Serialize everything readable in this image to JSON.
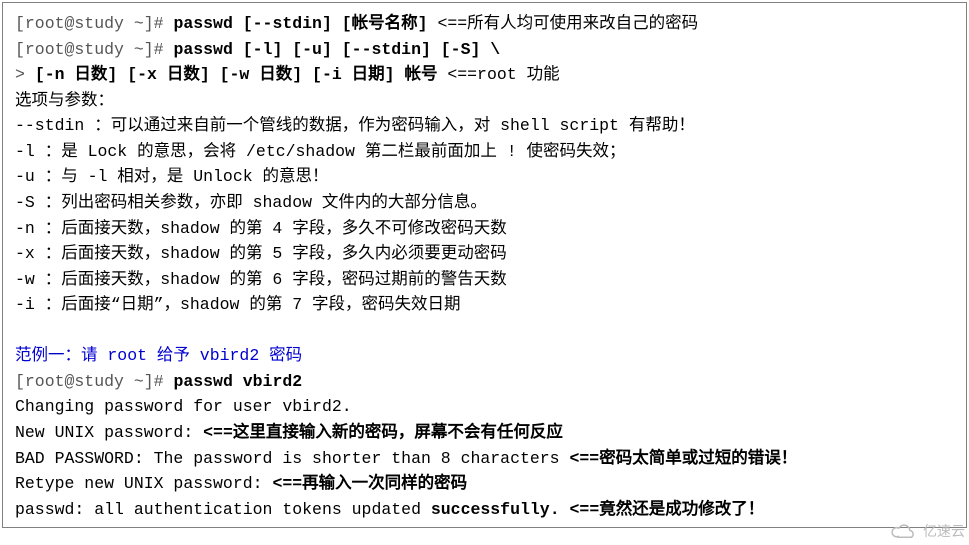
{
  "l01_prompt": "[root@study ~]# ",
  "l01_cmd": "passwd [--stdin] [帐号名称]",
  "l01_rem": "  <==所有人均可使用来改自己的密码",
  "l02_prompt": "[root@study ~]# ",
  "l02_cmd": "passwd [-l] [-u] [--stdin] [-S] \\",
  "l03_cont": ">  ",
  "l03_cmd": "[-n 日数] [-x 日数] [-w 日数] [-i 日期] 帐号",
  "l03_rem": " <==root 功能",
  "l04": "选项与参数：",
  "l05": "--stdin ：可以通过来自前一个管线的数据，作为密码输入，对 shell script 有帮助！",
  "l06": "-l  ：是 Lock 的意思，会将 /etc/shadow 第二栏最前面加上 ! 使密码失效；",
  "l07": "-u  ：与 -l 相对，是 Unlock 的意思！",
  "l08": "-S  ：列出密码相关参数，亦即 shadow 文件内的大部分信息。",
  "l09": "-n  ：后面接天数，shadow 的第 4 字段，多久不可修改密码天数",
  "l10": "-x  ：后面接天数，shadow 的第 5 字段，多久内必须要更动密码",
  "l11": "-w  ：后面接天数，shadow 的第 6 字段，密码过期前的警告天数",
  "l12": "-i  ：后面接“日期”，shadow 的第 7 字段，密码失效日期",
  "l14": "范例一：请 root 给予 vbird2 密码",
  "l15_prompt": "[root@study ~]# ",
  "l15_cmd": "passwd vbird2",
  "l16": "Changing password for user vbird2.",
  "l17a": "New UNIX password: ",
  "l17b": "<==这里直接输入新的密码，屏幕不会有任何反应",
  "l18a": "BAD PASSWORD: The password is shorter than 8 characters ",
  "l18b": "<==密码太简单或过短的错误！",
  "l19a": "Retype new UNIX password:  ",
  "l19b": "<==再输入一次同样的密码",
  "l20a": "passwd: all authentication tokens updated ",
  "l20b": "successfully.",
  "l20c": "  <==竟然还是成功修改了！",
  "logo": "亿速云"
}
